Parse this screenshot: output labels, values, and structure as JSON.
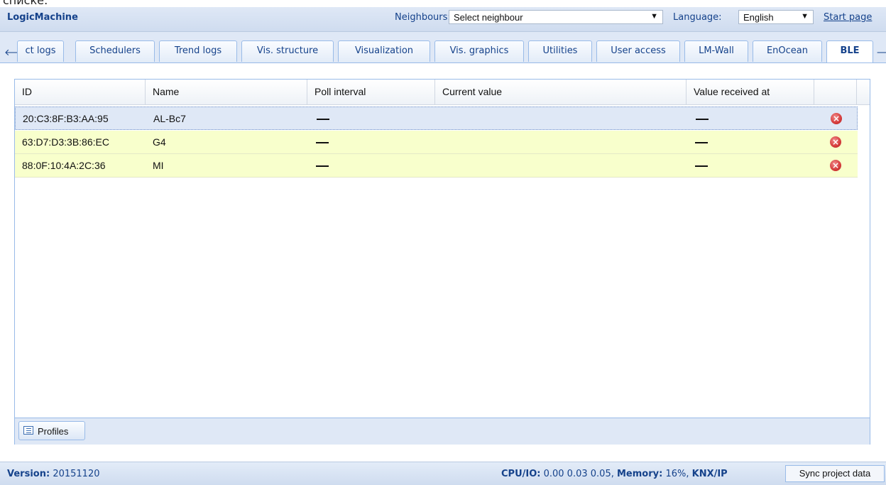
{
  "clipped_caption": "списке:",
  "header": {
    "brand": "LogicMachine",
    "neighbours_label": "Neighbours:",
    "neighbours_value": "Select neighbour",
    "language_label": "Language:",
    "language_value": "English",
    "start_page": "Start page"
  },
  "tabs": [
    {
      "label": "ct logs"
    },
    {
      "label": "Schedulers"
    },
    {
      "label": "Trend logs"
    },
    {
      "label": "Vis. structure"
    },
    {
      "label": "Visualization"
    },
    {
      "label": "Vis. graphics"
    },
    {
      "label": "Utilities"
    },
    {
      "label": "User access"
    },
    {
      "label": "LM-Wall"
    },
    {
      "label": "EnOcean"
    },
    {
      "label": "BLE",
      "active": true
    }
  ],
  "table": {
    "columns": [
      "ID",
      "Name",
      "Poll interval",
      "Current value",
      "Value received at"
    ],
    "rows": [
      {
        "id": "20:C3:8F:B3:AA:95",
        "name": "AL-Bc7",
        "state": "selected"
      },
      {
        "id": "63:D7:D3:3B:86:EC",
        "name": "G4",
        "state": "highlighted"
      },
      {
        "id": "88:0F:10:4A:2C:36",
        "name": "MI",
        "state": "highlighted"
      }
    ]
  },
  "footer": {
    "profiles_button": "Profiles"
  },
  "status": {
    "version_label": "Version:",
    "version_value": "20151120",
    "cpu_label": "CPU/IO:",
    "cpu_value": "0.00 0.03 0.05,",
    "memory_label": "Memory:",
    "memory_value": "16%,",
    "knx_label": "KNX/IP",
    "sync_button": "Sync project data"
  },
  "colors": {
    "header_text": "#15428b",
    "row_highlight": "#f8ffcc",
    "row_selected": "#dfe8f6"
  }
}
